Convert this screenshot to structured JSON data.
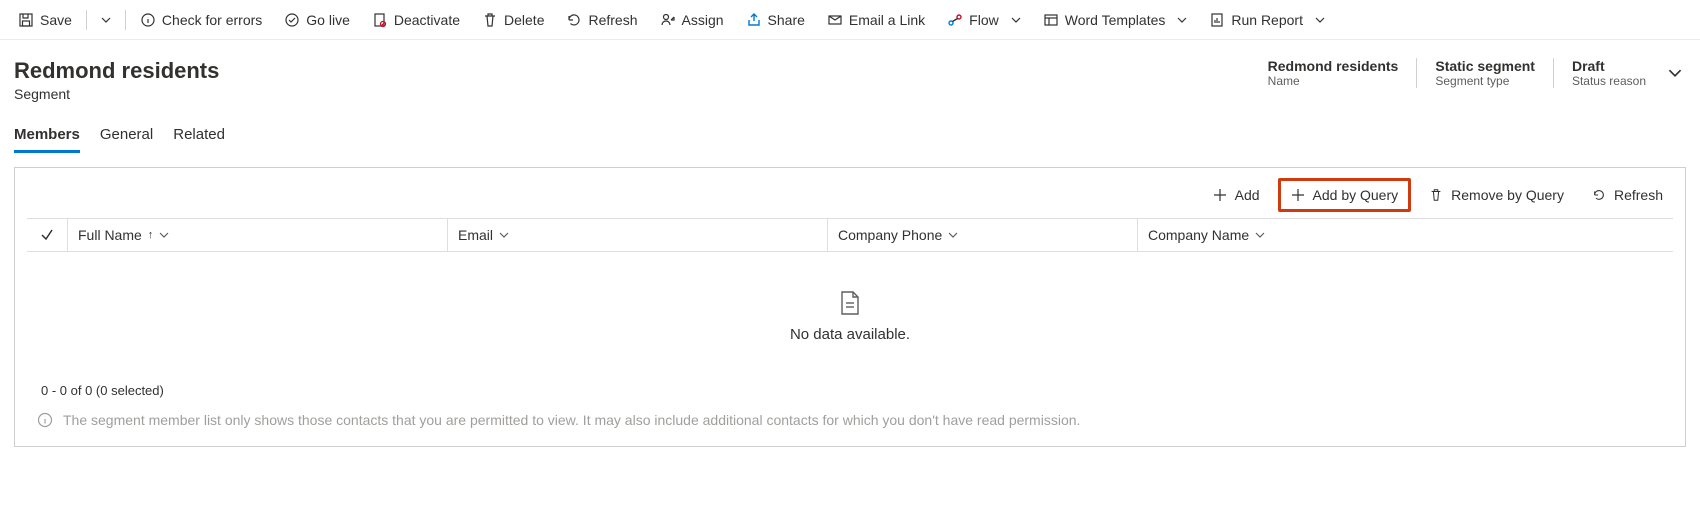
{
  "commandBar": {
    "save": "Save",
    "checkErrors": "Check for errors",
    "goLive": "Go live",
    "deactivate": "Deactivate",
    "delete": "Delete",
    "refresh": "Refresh",
    "assign": "Assign",
    "share": "Share",
    "emailLink": "Email a Link",
    "flow": "Flow",
    "wordTemplates": "Word Templates",
    "runReport": "Run Report"
  },
  "header": {
    "title": "Redmond residents",
    "entity": "Segment",
    "fields": {
      "nameValue": "Redmond residents",
      "nameLabel": "Name",
      "typeValue": "Static segment",
      "typeLabel": "Segment type",
      "statusValue": "Draft",
      "statusLabel": "Status reason"
    }
  },
  "tabs": {
    "members": "Members",
    "general": "General",
    "related": "Related"
  },
  "panel": {
    "toolbar": {
      "add": "Add",
      "addByQuery": "Add by Query",
      "removeByQuery": "Remove by Query",
      "refresh": "Refresh"
    },
    "columns": {
      "fullName": "Full Name",
      "email": "Email",
      "companyPhone": "Company Phone",
      "companyName": "Company Name"
    },
    "emptyText": "No data available.",
    "countText": "0 - 0 of 0 (0 selected)",
    "infoText": "The segment member list only shows those contacts that you are permitted to view. It may also include additional contacts for which you don't have read permission."
  }
}
